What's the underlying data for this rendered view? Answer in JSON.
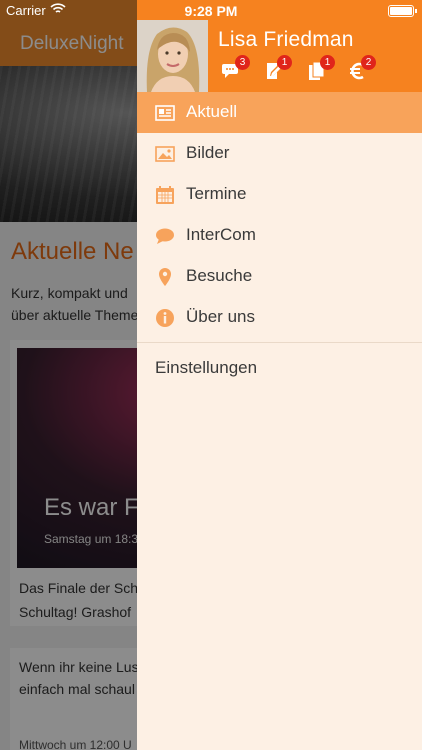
{
  "status_bar": {
    "carrier": "Carrier",
    "time": "9:28 PM"
  },
  "background": {
    "app_title": "DeluxeNight",
    "heading": "Aktuelle Ne",
    "intro": "Kurz, kompakt und\nüber aktuelle Theme",
    "card1": {
      "title": "Es war F",
      "date": "Samstag um 18:3",
      "text": "Das Finale der Sch\nSchultag! Grashof"
    },
    "card2": {
      "text": "Wenn ihr keine Lus\neinfach mal schaul",
      "date": "Mittwoch um 12:00 U"
    }
  },
  "drawer": {
    "user_name": "Lisa Friedman",
    "header_icons": [
      {
        "icon": "chat-bubbles-icon",
        "badge": "3"
      },
      {
        "icon": "edit-icon",
        "badge": "1"
      },
      {
        "icon": "documents-icon",
        "badge": "1"
      },
      {
        "icon": "euro-icon",
        "badge": "2"
      }
    ],
    "menu": [
      {
        "label": "Aktuell",
        "icon": "newspaper-icon",
        "active": true
      },
      {
        "label": "Bilder",
        "icon": "image-icon"
      },
      {
        "label": "Termine",
        "icon": "calendar-icon"
      },
      {
        "label": "InterCom",
        "icon": "speech-bubble-icon"
      },
      {
        "label": "Besuche",
        "icon": "map-pin-icon"
      },
      {
        "label": "Über uns",
        "icon": "info-icon"
      }
    ],
    "settings_label": "Einstellungen"
  },
  "colors": {
    "accent": "#f6821f",
    "active_item": "#f8a35a",
    "drawer_bg": "#fdf0e4",
    "icon": "#f7a35c",
    "badge": "#e0251b"
  }
}
